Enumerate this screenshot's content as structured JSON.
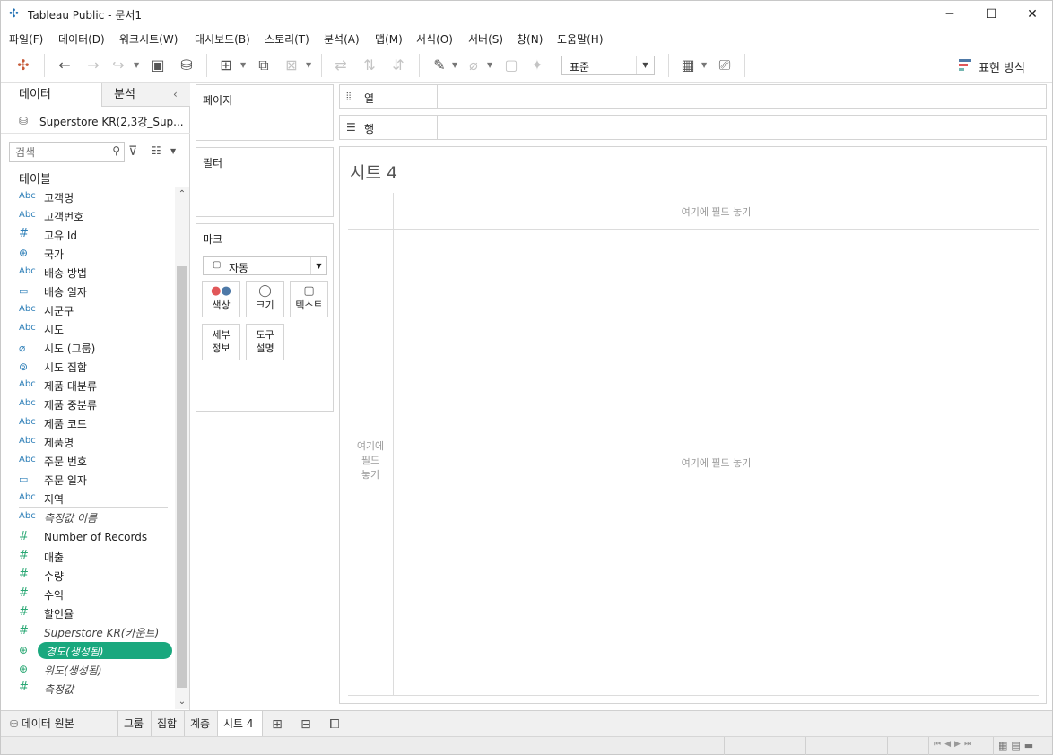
{
  "window": {
    "title": "Tableau Public - 문서1"
  },
  "menu": [
    "파일(F)",
    "데이터(D)",
    "워크시트(W)",
    "대시보드(B)",
    "스토리(T)",
    "분석(A)",
    "맵(M)",
    "서식(O)",
    "서버(S)",
    "창(N)",
    "도움말(H)"
  ],
  "toolbar": {
    "fit_value": "표준",
    "show_me_label": "표현 방식"
  },
  "data_pane": {
    "tab_data": "데이터",
    "tab_analysis": "분석",
    "datasource": "Superstore KR(2,3강_Sup...",
    "search_placeholder": "검색",
    "section_label": "테이블",
    "dimensions": [
      {
        "type": "Abc",
        "name": "고객명"
      },
      {
        "type": "Abc",
        "name": "고객번호"
      },
      {
        "type": "#",
        "name": "고유 Id"
      },
      {
        "type": "geo",
        "name": "국가"
      },
      {
        "type": "Abc",
        "name": "배송 방법"
      },
      {
        "type": "date",
        "name": "배송 일자"
      },
      {
        "type": "Abc",
        "name": "시군구"
      },
      {
        "type": "Abc",
        "name": "시도"
      },
      {
        "type": "clip",
        "name": "시도 (그룹)"
      },
      {
        "type": "set",
        "name": "시도 집합"
      },
      {
        "type": "Abc",
        "name": "제품 대분류"
      },
      {
        "type": "Abc",
        "name": "제품 중분류"
      },
      {
        "type": "Abc",
        "name": "제품 코드"
      },
      {
        "type": "Abc",
        "name": "제품명"
      },
      {
        "type": "Abc",
        "name": "주문 번호"
      },
      {
        "type": "date",
        "name": "주문 일자"
      },
      {
        "type": "Abc",
        "name": "지역"
      },
      {
        "type": "Abc",
        "name": "측정값 이름",
        "italic": true
      }
    ],
    "measures": [
      {
        "type": "#",
        "name": "Number of Records"
      },
      {
        "type": "#",
        "name": "매출"
      },
      {
        "type": "#",
        "name": "수량"
      },
      {
        "type": "#",
        "name": "수익"
      },
      {
        "type": "#",
        "name": "할인율"
      },
      {
        "type": "#",
        "name": "Superstore KR(카운트)",
        "italic": true
      },
      {
        "type": "geo",
        "name": "경도(생성됨)",
        "italic": true,
        "selected": true
      },
      {
        "type": "geo",
        "name": "위도(생성됨)",
        "italic": true
      },
      {
        "type": "#",
        "name": "측정값",
        "italic": true
      }
    ]
  },
  "cards": {
    "pages": "페이지",
    "filters": "필터",
    "marks": "마크",
    "marks_type": "자동",
    "mark_buttons": {
      "color": "색상",
      "size": "크기",
      "text": "텍스트",
      "detail": [
        "세부",
        "정보"
      ],
      "tooltip": [
        "도구",
        "설명"
      ]
    }
  },
  "shelves": {
    "columns": "열",
    "rows": "행"
  },
  "view": {
    "sheet_title": "시트 4",
    "drop_top": "여기에 필드 놓기",
    "drop_left": [
      "여기에",
      "필드",
      "놓기"
    ],
    "drop_center": "여기에 필드 놓기"
  },
  "bottom_tabs": {
    "datasource": "데이터 원본",
    "tabs": [
      "그룹",
      "집합",
      "계층",
      "시트 4"
    ]
  },
  "colors": {
    "accent_selected": "#1aa87e",
    "dimension": "#2e7fb8",
    "measure": "#2aa874"
  }
}
